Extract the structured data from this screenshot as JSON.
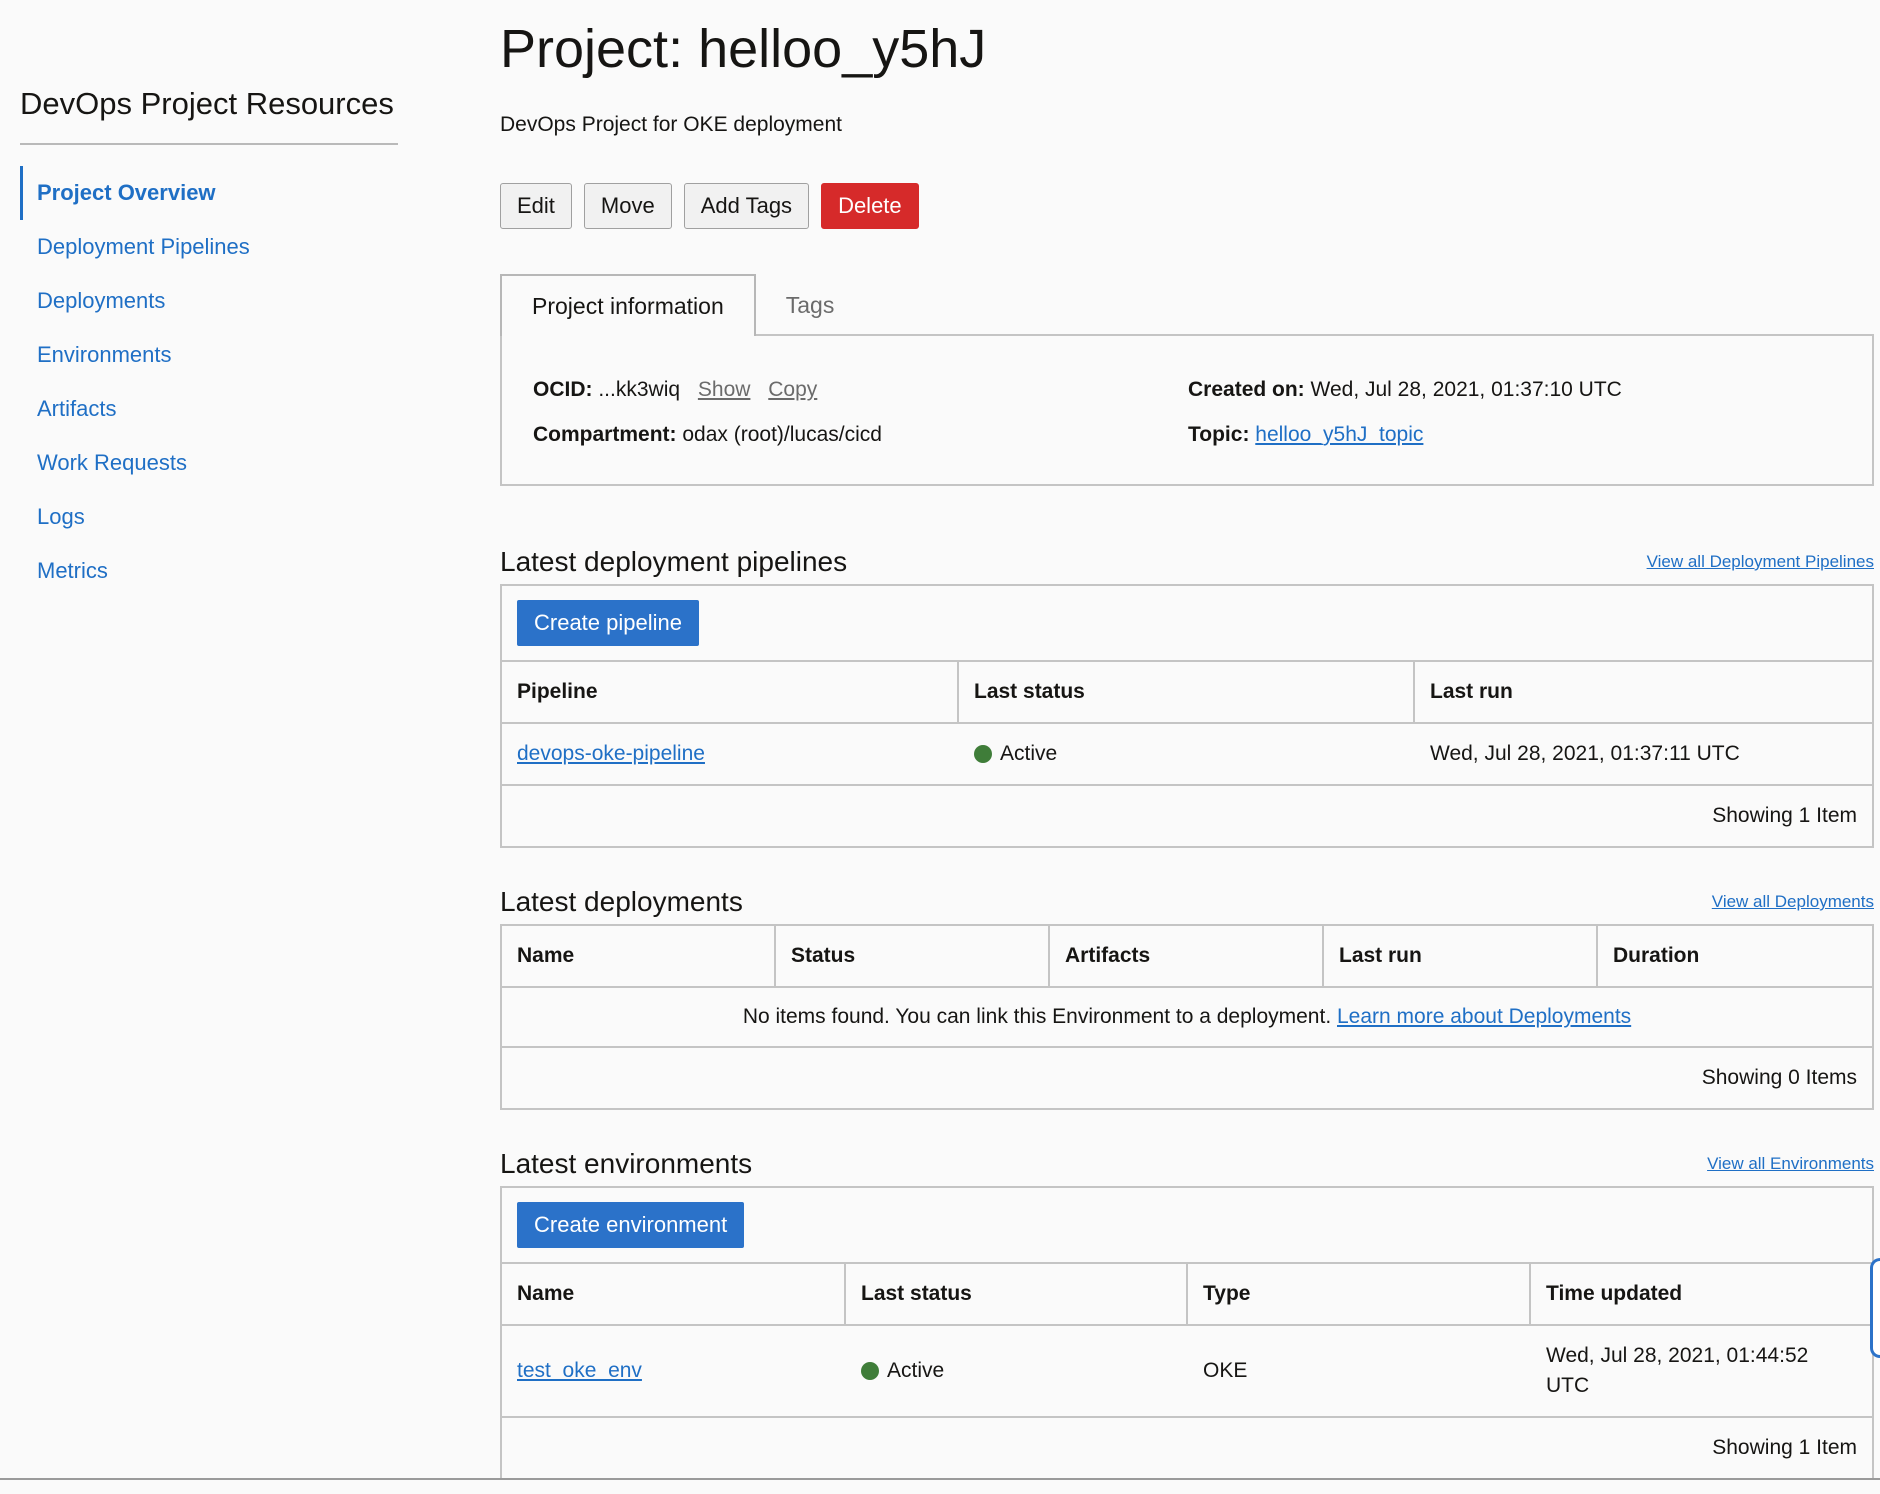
{
  "sidebar": {
    "title": "DevOps Project Resources",
    "items": [
      {
        "label": "Project Overview"
      },
      {
        "label": "Deployment Pipelines"
      },
      {
        "label": "Deployments"
      },
      {
        "label": "Environments"
      },
      {
        "label": "Artifacts"
      },
      {
        "label": "Work Requests"
      },
      {
        "label": "Logs"
      },
      {
        "label": "Metrics"
      }
    ]
  },
  "header": {
    "title": "Project: helloo_y5hJ",
    "description": "DevOps Project for OKE deployment"
  },
  "actions": {
    "edit": "Edit",
    "move": "Move",
    "add_tags": "Add Tags",
    "delete": "Delete"
  },
  "tabs": [
    {
      "label": "Project information"
    },
    {
      "label": "Tags"
    }
  ],
  "info": {
    "ocid_label": "OCID:",
    "ocid_value": "...kk3wiq",
    "show": "Show",
    "copy": "Copy",
    "compartment_label": "Compartment:",
    "compartment_value": "odax (root)/lucas/cicd",
    "created_label": "Created on:",
    "created_value": "Wed, Jul 28, 2021, 01:37:10 UTC",
    "topic_label": "Topic:",
    "topic_value": "helloo_y5hJ_topic"
  },
  "pipelines": {
    "title": "Latest deployment pipelines",
    "view_all": "View all Deployment Pipelines",
    "create": "Create pipeline",
    "columns": [
      "Pipeline",
      "Last status",
      "Last run"
    ],
    "rows": [
      {
        "name": "devops-oke-pipeline",
        "status": "Active",
        "last_run": "Wed, Jul 28, 2021, 01:37:11 UTC"
      }
    ],
    "footer": "Showing 1 Item"
  },
  "deployments": {
    "title": "Latest deployments",
    "view_all": "View all Deployments",
    "columns": [
      "Name",
      "Status",
      "Artifacts",
      "Last run",
      "Duration"
    ],
    "empty_text": "No items found. You can link this Environment to a deployment.",
    "empty_link": "Learn more about Deployments",
    "footer": "Showing 0 Items"
  },
  "environments": {
    "title": "Latest environments",
    "view_all": "View all Environments",
    "create": "Create environment",
    "columns": [
      "Name",
      "Last status",
      "Type",
      "Time updated"
    ],
    "rows": [
      {
        "name": "test_oke_env",
        "status": "Active",
        "type": "OKE",
        "time_updated_1": "Wed, Jul 28, 2021, 01:44:52",
        "time_updated_2": "UTC"
      }
    ],
    "footer": "Showing 1 Item"
  },
  "colors": {
    "link": "#1f6fc5",
    "primary": "#2b72c9",
    "danger": "#d62a2a",
    "active_dot": "#3f7d39"
  }
}
